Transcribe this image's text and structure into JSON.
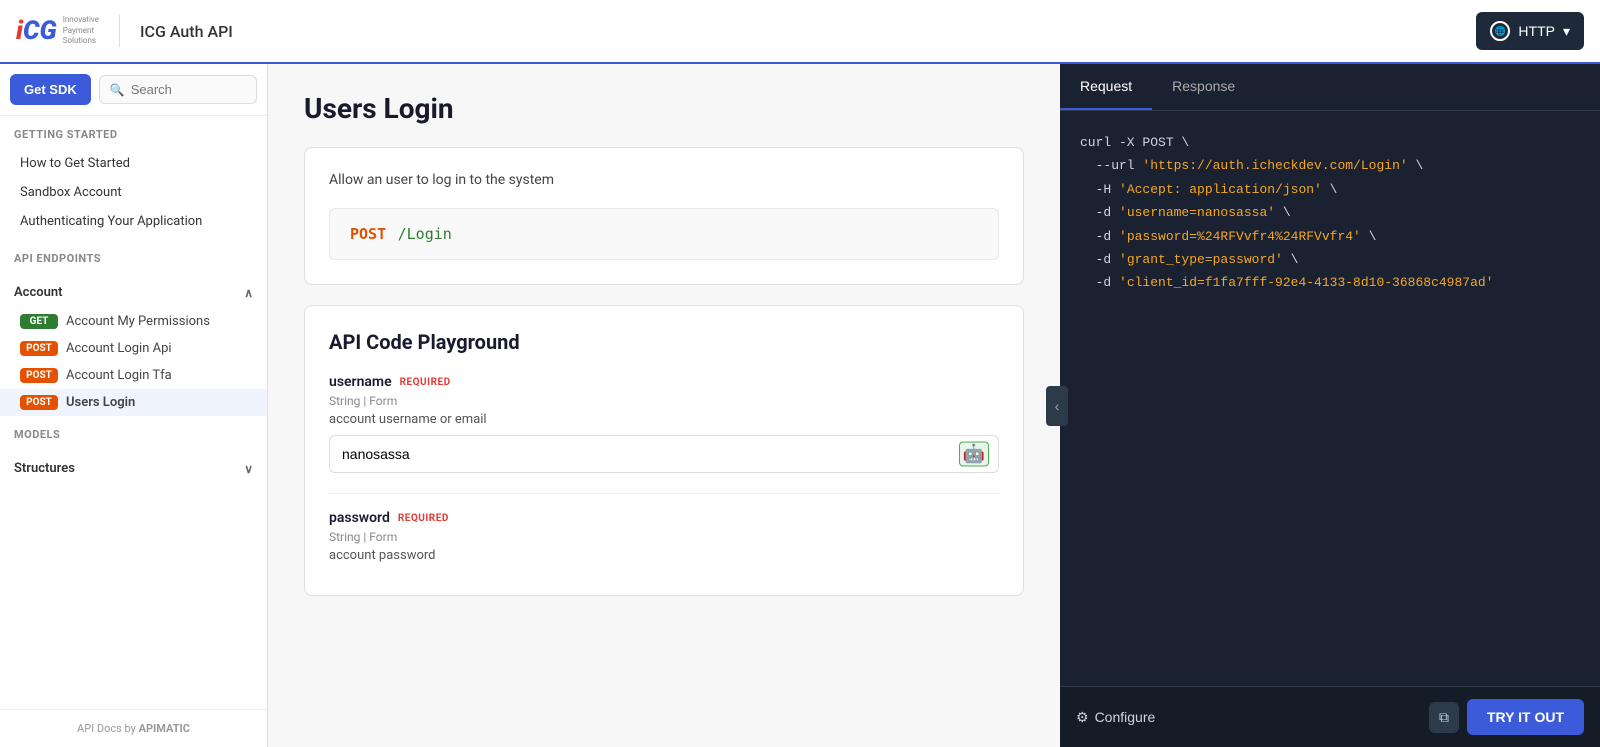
{
  "header": {
    "logo_i": "i",
    "logo_cg": "CG",
    "logo_tagline": "Innovative\nPayment\nSolutions",
    "api_title": "ICG Auth API",
    "http_label": "HTTP",
    "chevron": "▾"
  },
  "sidebar": {
    "get_sdk_label": "Get SDK",
    "search_placeholder": "Search",
    "sections": [
      {
        "title": "GETTING STARTED",
        "items": [
          {
            "label": "How to Get Started"
          },
          {
            "label": "Sandbox Account"
          },
          {
            "label": "Authenticating Your Application"
          }
        ]
      },
      {
        "title": "API ENDPOINTS"
      }
    ],
    "account_group": {
      "label": "Account",
      "expanded": true,
      "items": [
        {
          "method": "GET",
          "label": "Account My Permissions",
          "active": false
        },
        {
          "method": "POST",
          "label": "Account Login Api",
          "active": false
        },
        {
          "method": "POST",
          "label": "Account Login Tfa",
          "active": false
        },
        {
          "method": "POST",
          "label": "Users Login",
          "active": true
        }
      ]
    },
    "models_group": {
      "label": "MODELS",
      "items": [
        {
          "label": "Structures"
        }
      ]
    },
    "footer": "API Docs by APIMATIC"
  },
  "main": {
    "page_title": "Users Login",
    "description": "Allow an user to log in to the system",
    "endpoint": {
      "method": "POST",
      "path": "/Login"
    },
    "playground_title": "API Code Playground",
    "fields": [
      {
        "name": "username",
        "required_label": "REQUIRED",
        "meta": "String | Form",
        "description": "account username or email",
        "value": "nanosassa",
        "has_icon": true
      },
      {
        "name": "password",
        "required_label": "REQUIRED",
        "meta": "String | Form",
        "description": "account password",
        "value": ""
      }
    ]
  },
  "right_panel": {
    "tabs": [
      {
        "label": "Request",
        "active": true
      },
      {
        "label": "Response",
        "active": false
      }
    ],
    "code_lines": [
      {
        "type": "plain",
        "text": "curl -X POST \\"
      },
      {
        "type": "indent_url",
        "prefix": "  --url '",
        "url": "https://auth.icheckdev.com/Login",
        "suffix": "' \\"
      },
      {
        "type": "indent_string",
        "text": "  -H 'Accept: application/json' \\"
      },
      {
        "type": "indent_string",
        "text": "  -d 'username=nanosassa' \\"
      },
      {
        "type": "indent_string",
        "text": "  -d 'password=%24RFVvfr4%24RFVvfr4' \\"
      },
      {
        "type": "indent_string",
        "text": "  -d 'grant_type=password' \\"
      },
      {
        "type": "indent_string",
        "text": "  -d 'client_id=f1fa7fff-92e4-4133-8d10-36868c4987ad'"
      }
    ],
    "configure_label": "Configure",
    "copy_icon": "⧉",
    "try_it_out_label": "TRY IT OUT"
  }
}
